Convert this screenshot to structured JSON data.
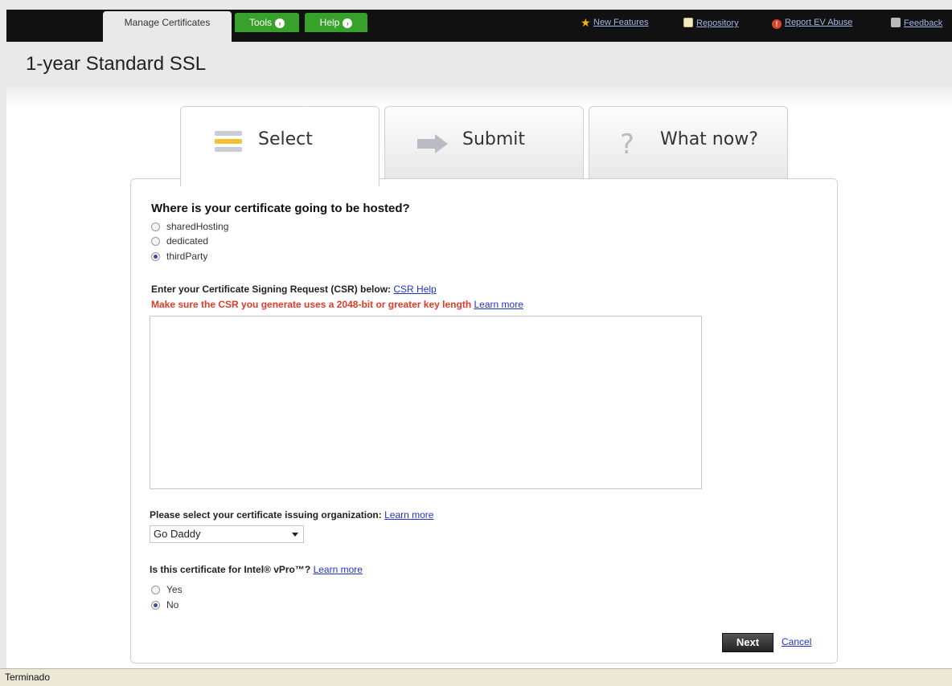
{
  "nav": {
    "tabs": [
      {
        "label": "Manage Certificates"
      },
      {
        "label": "Tools"
      },
      {
        "label": "Help"
      }
    ],
    "links": [
      {
        "label": "New Features",
        "icon": "star-icon"
      },
      {
        "label": "Repository",
        "icon": "document-icon"
      },
      {
        "label": "Report EV Abuse",
        "icon": "alert-icon"
      },
      {
        "label": "Feedback",
        "icon": "chat-icon"
      }
    ]
  },
  "page": {
    "title": "1-year Standard SSL"
  },
  "steps": [
    {
      "label": "Select",
      "active": true,
      "icon": "stack-icon"
    },
    {
      "label": "Submit",
      "active": false,
      "icon": "arrow-right-icon"
    },
    {
      "label": "What now?",
      "active": false,
      "icon": "question-icon"
    }
  ],
  "form": {
    "hosting": {
      "question": "Where is your certificate going to be hosted?",
      "options": [
        {
          "label": "sharedHosting",
          "checked": false
        },
        {
          "label": "dedicated",
          "checked": false
        },
        {
          "label": "thirdParty",
          "checked": true
        }
      ]
    },
    "csr": {
      "label": "Enter your Certificate Signing Request (CSR) below:",
      "help_link": "CSR Help",
      "warning": "Make sure the CSR you generate uses a 2048-bit or greater key length",
      "learn_more": "Learn more",
      "value": ""
    },
    "org": {
      "label": "Please select your certificate issuing organization:",
      "learn_more": "Learn more",
      "selected": "Go Daddy"
    },
    "vpro": {
      "label": "Is this certificate for Intel® vPro™?",
      "learn_more": "Learn more",
      "options": [
        {
          "label": "Yes",
          "checked": false
        },
        {
          "label": "No",
          "checked": true
        }
      ]
    },
    "actions": {
      "next": "Next",
      "cancel": "Cancel"
    }
  },
  "colors": {
    "nav_green": "#37a12b",
    "warning_red": "#e23a2a",
    "link_blue": "#2233cc"
  },
  "status": {
    "text": "Terminado"
  }
}
